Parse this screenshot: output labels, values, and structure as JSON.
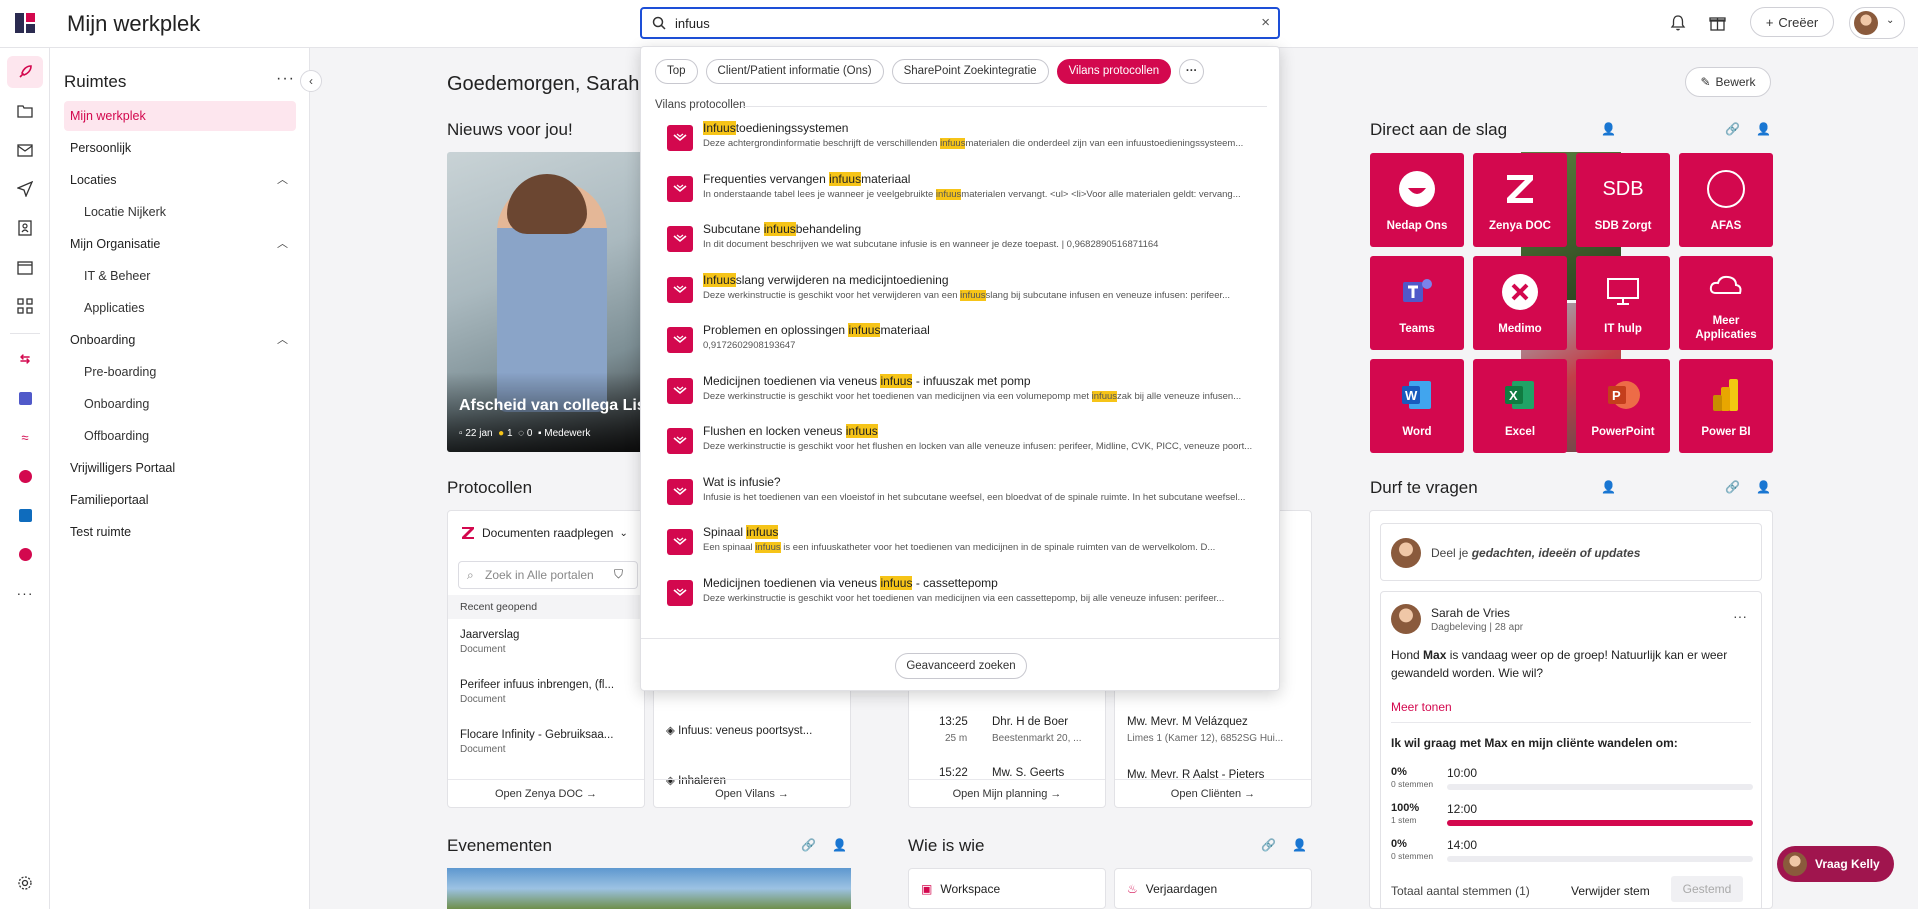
{
  "app": {
    "title": "Mijn werkplek"
  },
  "search": {
    "value": "infuus",
    "clear_label": "×"
  },
  "header": {
    "create_label": "Creëer"
  },
  "sidebar": {
    "title": "Ruimtes",
    "more": "···",
    "collapse": "‹",
    "items": [
      {
        "label": "Mijn werkplek"
      },
      {
        "label": "Persoonlijk"
      },
      {
        "label": "Locaties"
      },
      {
        "label": "Locatie Nijkerk"
      },
      {
        "label": "Mijn Organisatie"
      },
      {
        "label": "IT & Beheer"
      },
      {
        "label": "Applicaties"
      },
      {
        "label": "Onboarding"
      },
      {
        "label": "Pre-boarding"
      },
      {
        "label": "Onboarding"
      },
      {
        "label": "Offboarding"
      },
      {
        "label": "Vrijwilligers Portaal"
      },
      {
        "label": "Familieportaal"
      },
      {
        "label": "Test ruimte"
      }
    ]
  },
  "main": {
    "greeting": "Goedemorgen, Sarah",
    "edit_label": "Bewerk",
    "news": {
      "title": "Nieuws voor jou!",
      "item_title": "Afscheid van collega Lis",
      "item_date": "22 jan",
      "item_likes": "1",
      "item_comments": "0",
      "item_tag": "Medewerk"
    },
    "protocols": {
      "title": "Protocollen",
      "dropdown": "Documenten raadplegen",
      "search_placeholder": "Zoek in Alle portalen",
      "recent": "Recent geopend",
      "rows": [
        {
          "title": "Jaarverslag",
          "type": "Document"
        },
        {
          "title": "Perifeer infuus inbrengen, (fl...",
          "type": "Document"
        },
        {
          "title": "Flocare Infinity - Gebruiksaa...",
          "type": "Document"
        }
      ],
      "footer": "Open Zenya DOC →",
      "vilans_rows": [
        "Infuus: veneus poortsyst...",
        "Inhaleren"
      ],
      "vilans_footer": "Open Vilans →"
    },
    "planning": {
      "rows": [
        {
          "time": "13:25",
          "dur": "25 m",
          "name": "Dhr. H de Boer",
          "addr": "Beestenmarkt 20, ..."
        },
        {
          "time": "15:22",
          "dur": "",
          "name": "Mw. S. Geerts",
          "addr": ""
        }
      ],
      "footer": "Open Mijn planning →"
    },
    "clients": {
      "rows": [
        {
          "name": "Mw. Mevr. M Velázquez",
          "addr": "Limes 1 (Kamer 12), 6852SG Hui..."
        },
        {
          "name": "Mw. Mevr. R Aalst - Pieters",
          "addr": ""
        }
      ],
      "footer": "Open Cliënten →"
    },
    "direct": {
      "title": "Direct aan de slag",
      "tiles": [
        "Nedap Ons",
        "Zenya DOC",
        "SDB Zorgt",
        "AFAS",
        "Teams",
        "Medimo",
        "IT hulp",
        "Meer Applicaties",
        "Word",
        "Excel",
        "PowerPoint",
        "Power BI"
      ]
    },
    "durf": {
      "title": "Durf te vragen",
      "placeholder_prefix": "Deel je ",
      "placeholder_em": "gedachten, ideeën of updates",
      "post": {
        "author": "Sarah de Vries",
        "date": "Dagbeleving | 28 apr",
        "body_prefix": "Hond ",
        "body_bold": "Max",
        "body_suffix": " is vandaag weer op de groep! Natuurlijk kan er weer gewandeld worden. Wie wil?",
        "more_link": "Meer tonen",
        "question": "Ik wil graag met Max en mijn cliënte wandelen om:",
        "poll": [
          {
            "pct": "0%",
            "votes": "0 stemmen",
            "option": "10:00",
            "value": 0
          },
          {
            "pct": "100%",
            "votes": "1 stem",
            "option": "12:00",
            "value": 1
          },
          {
            "pct": "0%",
            "votes": "0 stemmen",
            "option": "14:00",
            "value": 0
          }
        ],
        "total": "Totaal aantal stemmen (1)",
        "remove": "Verwijder stem",
        "voted": "Gestemd"
      }
    },
    "events": {
      "title": "Evenementen"
    },
    "wie": {
      "title": "Wie is wie",
      "cards": [
        "Workspace",
        "Verjaardagen"
      ]
    },
    "kelly": "Vraag Kelly"
  },
  "dropdown": {
    "chips": [
      "Top",
      "Client/Patient informatie (Ons)",
      "SharePoint Zoekintegratie",
      "Vilans protocollen",
      "···"
    ],
    "section_label": "Vilans protocollen",
    "results": [
      {
        "t_pre": "",
        "t_hl": "Infuus",
        "t_post": "toedieningssystemen",
        "d_pre": "Deze achtergrondinformatie beschrijft de verschillenden ",
        "d_hl": "infuus",
        "d_post": "materialen die onderdeel zijn van een infuustoedieningssysteem..."
      },
      {
        "t_pre": "Frequenties vervangen ",
        "t_hl": "infuus",
        "t_post": "materiaal",
        "d_pre": "In onderstaande tabel lees je wanneer je veelgebruikte ",
        "d_hl": "infuus",
        "d_post": "materialen vervangt. <ul> <li>Voor alle materialen geldt: vervang..."
      },
      {
        "t_pre": "Subcutane ",
        "t_hl": "infuus",
        "t_post": "behandeling",
        "d_pre": "In dit document beschrijven we wat subcutane infusie is en wanneer je deze toepast. | 0,9682890516871164",
        "d_hl": "",
        "d_post": ""
      },
      {
        "t_pre": "",
        "t_hl": "Infuus",
        "t_post": "slang verwijderen na medicijntoediening",
        "d_pre": "Deze werkinstructie is geschikt voor het verwijderen van een ",
        "d_hl": "infuus",
        "d_post": "slang bij subcutane infusen en veneuze infusen: perifeer..."
      },
      {
        "t_pre": "Problemen en oplossingen ",
        "t_hl": "infuus",
        "t_post": "materiaal",
        "d_pre": "0,9172602908193647",
        "d_hl": "",
        "d_post": ""
      },
      {
        "t_pre": "Medicijnen toedienen via veneus ",
        "t_hl": "infuus",
        "t_post": " - infuuszak met pomp",
        "d_pre": "Deze werkinstructie is geschikt voor het toedienen van medicijnen via een volumepomp met ",
        "d_hl": "infuus",
        "d_post": "zak bij alle veneuze infusen..."
      },
      {
        "t_pre": "Flushen en locken veneus ",
        "t_hl": "infuus",
        "t_post": "",
        "d_pre": "Deze werkinstructie is geschikt voor het flushen en locken van alle veneuze infusen: perifeer, Midline, CVK, PICC, veneuze poort...",
        "d_hl": "",
        "d_post": ""
      },
      {
        "t_pre": "Wat is infusie?",
        "t_hl": "",
        "t_post": "",
        "d_pre": "Infusie is het toedienen van een vloeistof in het subcutane weefsel, een bloedvat of de spinale ruimte. In het subcutane weefsel...",
        "d_hl": "",
        "d_post": ""
      },
      {
        "t_pre": "Spinaal ",
        "t_hl": "infuus",
        "t_post": "",
        "d_pre": "Een spinaal ",
        "d_hl": "infuus",
        "d_post": " is een infuuskatheter voor het toedienen van medicijnen in de spinale ruimten van de wervelkolom. D..."
      },
      {
        "t_pre": "Medicijnen toedienen via veneus ",
        "t_hl": "infuus",
        "t_post": " - cassettepomp",
        "d_pre": "Deze werkinstructie is geschikt voor het toedienen van medicijnen via een cassettepomp, bij alle veneuze infusen: perifeer..."
      }
    ],
    "advanced": "Geavanceerd zoeken"
  },
  "colors": {
    "accent": "#d3084e",
    "highlight": "#f6c418",
    "focus": "#1d4fd7"
  }
}
